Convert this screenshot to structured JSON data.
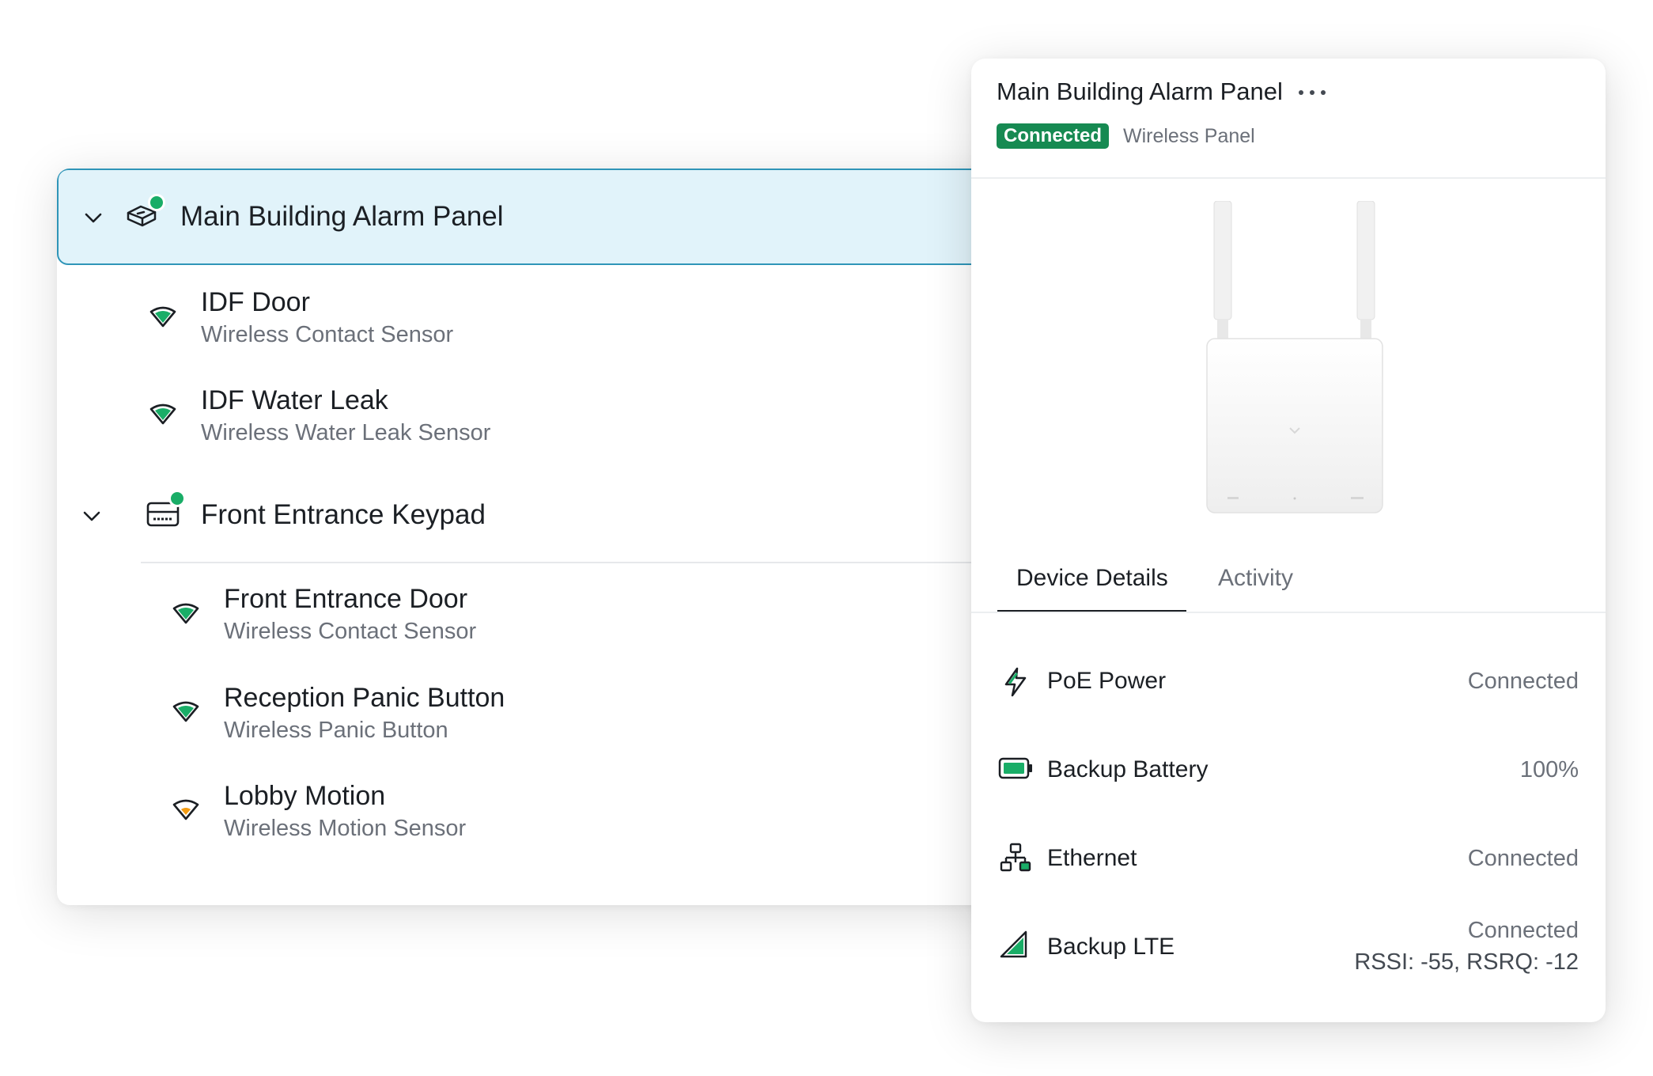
{
  "tree": {
    "root": {
      "label": "Main Building Alarm Panel"
    },
    "root_children": [
      {
        "title": "IDF Door",
        "subtitle": "Wireless Contact Sensor"
      },
      {
        "title": "IDF Water Leak",
        "subtitle": "Wireless Water Leak Sensor"
      }
    ],
    "keypad": {
      "label": "Front Entrance Keypad"
    },
    "keypad_children": [
      {
        "title": "Front Entrance Door",
        "subtitle": "Wireless Contact Sensor"
      },
      {
        "title": "Reception Panic Button",
        "subtitle": "Wireless Panic Button"
      },
      {
        "title": "Lobby Motion",
        "subtitle": "Wireless Motion Sensor"
      }
    ]
  },
  "details": {
    "title": "Main Building Alarm Panel",
    "status_badge": "Connected",
    "device_type": "Wireless Panel",
    "tabs": [
      {
        "label": "Device Details",
        "active": true
      },
      {
        "label": "Activity",
        "active": false
      }
    ],
    "properties": [
      {
        "label": "PoE Power",
        "value": "Connected"
      },
      {
        "label": "Backup Battery",
        "value": "100%"
      },
      {
        "label": "Ethernet",
        "value": "Connected"
      },
      {
        "label": "Backup LTE",
        "value": "Connected",
        "detail": "RSSI: -55, RSRQ: -12"
      }
    ]
  },
  "colors": {
    "status_green": "#19ad67",
    "badge_green": "#168a52",
    "selected_bg": "#e1f3fa",
    "selected_border": "#2f95b8",
    "motion_orange": "#f39c12"
  },
  "icons": {
    "chevron": "chevron-down-icon",
    "panel": "alarm-panel-icon",
    "keypad": "keypad-icon",
    "signal": "wireless-signal-icon",
    "poe": "lightning-icon",
    "battery": "battery-icon",
    "ethernet": "ethernet-icon",
    "lte": "cellular-icon"
  }
}
